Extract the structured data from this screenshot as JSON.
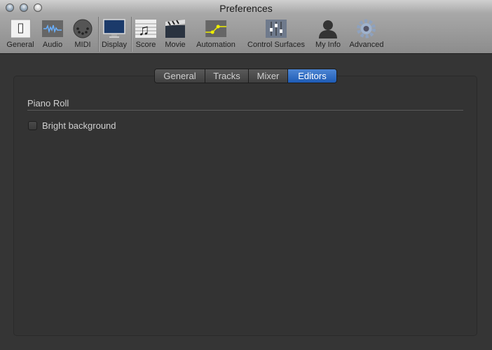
{
  "window": {
    "title": "Preferences"
  },
  "toolbar": [
    {
      "label": "General",
      "icon": "switch-icon"
    },
    {
      "label": "Audio",
      "icon": "waveform-icon"
    },
    {
      "label": "MIDI",
      "icon": "midi-connector-icon"
    },
    {
      "label": "Display",
      "icon": "monitor-icon"
    },
    {
      "label": "Score",
      "icon": "music-notes-icon"
    },
    {
      "label": "Movie",
      "icon": "clapperboard-icon"
    },
    {
      "label": "Automation",
      "icon": "automation-curve-icon"
    },
    {
      "label": "Control Surfaces",
      "icon": "faders-icon"
    },
    {
      "label": "My Info",
      "icon": "person-icon"
    },
    {
      "label": "Advanced",
      "icon": "gear-icon"
    }
  ],
  "tabs": [
    {
      "label": "General"
    },
    {
      "label": "Tracks"
    },
    {
      "label": "Mixer"
    },
    {
      "label": "Editors",
      "selected": true
    }
  ],
  "section": {
    "title": "Piano Roll",
    "options": [
      {
        "label": "Bright background",
        "checked": false
      }
    ]
  },
  "colors": {
    "accent": "#2f6cc4",
    "background": "#353535"
  }
}
